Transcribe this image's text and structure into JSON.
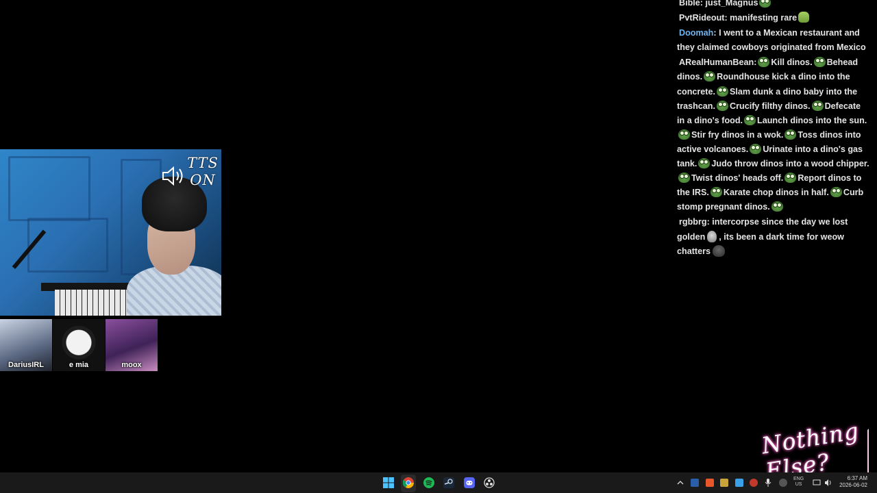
{
  "webcam": {
    "overlay_text": "TTS ON"
  },
  "participants": [
    {
      "name": "DariusIRL"
    },
    {
      "name": "e mia"
    },
    {
      "name": "moox"
    }
  ],
  "chat": {
    "messages": [
      {
        "user": "Bible",
        "text": "just_Magnus",
        "emotes": [
          "pepe"
        ]
      },
      {
        "user": "PvtRideout",
        "text": "manifesting rare",
        "emotes": [
          "hand"
        ]
      },
      {
        "user": "Doomah",
        "user_color": "#6fb4f2",
        "text": "I went to a Mexican restaurant and they claimed cowboys originated from Mexico"
      },
      {
        "user": "ARealHumanBean",
        "segments": [
          "Kill dinos.",
          "Behead dinos.",
          "Roundhouse kick a dino into the concrete.",
          "Slam dunk a dino baby into the trashcan.",
          "Crucify filthy dinos.",
          "Defecate in a dino's food.",
          "Launch dinos into the sun.",
          "Stir fry dinos in a wok.",
          "Toss dinos into active volcanoes.",
          "Urinate into a dino's gas tank.",
          "Judo throw dinos into a wood chipper.",
          "Twist dinos' heads off.",
          "Report dinos to the IRS.",
          "Karate chop dinos in half.",
          "Curb stomp pregnant dinos."
        ]
      },
      {
        "user": "rgbbrg",
        "text_before": "intercorpse since the day we lost golden",
        "text_after": ", its been a dark time for weow chatters"
      }
    ]
  },
  "logo": {
    "text": "Nothing Else?"
  },
  "taskbar": {
    "apps": [
      "windows-start",
      "chrome",
      "spotify",
      "steam",
      "discord",
      "obs"
    ],
    "lang_top": "ENG",
    "lang_bottom": "US",
    "time": "6:37 AM",
    "date": "2026-06-02"
  },
  "colors": {
    "background": "#000000",
    "doomah_name": "#6fb4f2",
    "logo_glow": "#ff4fbf"
  }
}
